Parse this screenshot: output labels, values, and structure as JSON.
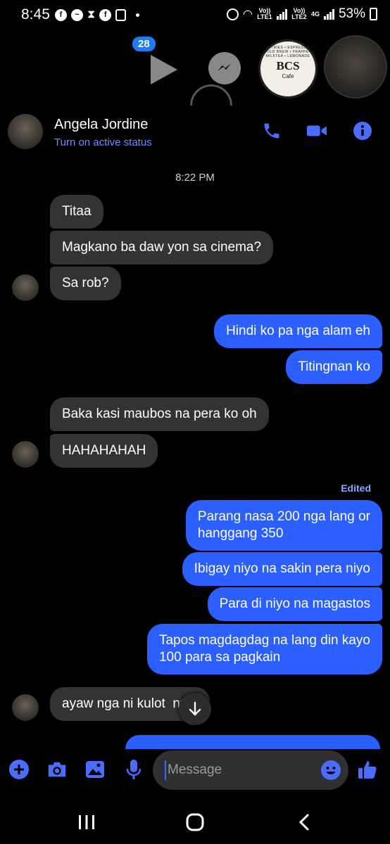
{
  "status_bar": {
    "time": "8:45",
    "net1_label": "Vo)) LTE1",
    "net2_label": "Vo)) LTE2",
    "net2_type": "4G",
    "battery": "53%"
  },
  "chat_heads": {
    "badge_count": "28",
    "cafe_name": "BCS",
    "cafe_sub": "Cafe",
    "cafe_ring": "PASTRIES • ESPRESSO • COLD BREW • FRAPPE • MILKTEA • LEMONADE"
  },
  "header": {
    "name": "Angela Jordine",
    "status": "Turn on active status"
  },
  "timestamp": "8:22 PM",
  "messages": [
    {
      "dir": "in",
      "text": "Titaa"
    },
    {
      "dir": "in",
      "text": "Magkano ba daw yon sa cinema?"
    },
    {
      "dir": "in",
      "text": "Sa rob?"
    },
    {
      "dir": "out",
      "text": "Hindi ko pa nga alam eh"
    },
    {
      "dir": "out",
      "text": "Titingnan ko"
    },
    {
      "dir": "in",
      "text": "Baka kasi maubos na pera ko oh"
    },
    {
      "dir": "in",
      "text": "HAHAHAHAH"
    },
    {
      "dir": "out",
      "text": "Parang nasa 200 nga lang or\nhanggang 350"
    },
    {
      "dir": "out",
      "text": "Ibigay niyo na sakin pera niyo"
    },
    {
      "dir": "out",
      "text": "Para di niyo na magastos"
    },
    {
      "dir": "out",
      "text": "Tapos magdagdag na lang din kayo\n100 para sa pagkain"
    },
    {
      "dir": "in",
      "text": "ayaw nga ni kulot  ny e"
    }
  ],
  "edited_label": "Edited",
  "composer": {
    "placeholder": "Message"
  },
  "colors": {
    "accent": "#2b5fff",
    "incoming_bubble": "#333335",
    "icon_blue": "#4a6cff",
    "status_link": "#6b8cff"
  }
}
